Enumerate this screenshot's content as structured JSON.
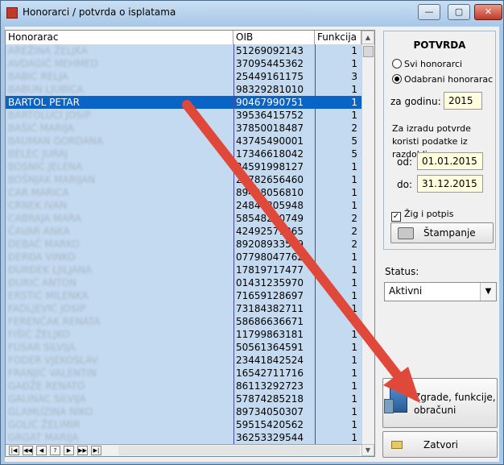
{
  "window": {
    "title": "Honorarci / potvrda o isplatama",
    "min_glyph": "—",
    "max_glyph": "▢",
    "close_glyph": "✕"
  },
  "grid": {
    "columns": [
      "Honorarac",
      "OIB",
      "Funkcija"
    ],
    "rows": [
      {
        "name": "AREŽINA ŽELJKA",
        "oib": "51269092143",
        "func": "1"
      },
      {
        "name": "AVDAGIĆ MEHMED",
        "oib": "37095445362",
        "func": "1"
      },
      {
        "name": "BABIĆ RELJA",
        "oib": "25449161175",
        "func": "3"
      },
      {
        "name": "BABUN LJUBICA",
        "oib": "98329281010",
        "func": "1"
      },
      {
        "name": "BARTOL PETAR",
        "oib": "90467990751",
        "func": "1",
        "selected": true
      },
      {
        "name": "BARTOLUCI JOSIP",
        "oib": "39536415752",
        "func": "1"
      },
      {
        "name": "BAŠIĆ MARIJA",
        "oib": "37850018487",
        "func": "2"
      },
      {
        "name": "BAUMAN GORDANA",
        "oib": "43745490001",
        "func": "5"
      },
      {
        "name": "BELEC JURAJ",
        "oib": "17346618042",
        "func": "5"
      },
      {
        "name": "BOSNIĆ JELENA",
        "oib": "24591998127",
        "func": "1"
      },
      {
        "name": "BOŠNJAK MARIJAN",
        "oib": "28782656460",
        "func": "1"
      },
      {
        "name": "CAR MARICA",
        "oib": "89438056810",
        "func": "1"
      },
      {
        "name": "CRNEK IVAN",
        "oib": "24848305948",
        "func": "1"
      },
      {
        "name": "CABRAJA MARA",
        "oib": "58548260749",
        "func": "2"
      },
      {
        "name": "ČAVAR ANKA",
        "oib": "42492571365",
        "func": "2"
      },
      {
        "name": "DEBAČ MARKO",
        "oib": "89208933549",
        "func": "2"
      },
      {
        "name": "ĐERĐA VINKO",
        "oib": "07798047762",
        "func": "1"
      },
      {
        "name": "ĐURĐEK LJILJANA",
        "oib": "17819717477",
        "func": "1"
      },
      {
        "name": "ĐURIĆ ANTON",
        "oib": "01431235970",
        "func": "1"
      },
      {
        "name": "ERSTIĆ MILENKA",
        "oib": "71659128697",
        "func": "1"
      },
      {
        "name": "FADLJEVIĆ JOSIP",
        "oib": "73184382711",
        "func": "1"
      },
      {
        "name": "FERENČAK RENATA",
        "oib": "58686636671",
        "func": "1"
      },
      {
        "name": "FIŠIĆ ŽELJKO",
        "oib": "11799863181",
        "func": "1"
      },
      {
        "name": "FUSAR SILVIJA",
        "oib": "50561364591",
        "func": "1"
      },
      {
        "name": "FODER VJEKOSLAV",
        "oib": "23441842524",
        "func": "1"
      },
      {
        "name": "FRANJIĆ VALENTIN",
        "oib": "16542711716",
        "func": "1"
      },
      {
        "name": "GAĐŽE RENATO",
        "oib": "86113292723",
        "func": "1"
      },
      {
        "name": "GALINAC SILVIJA",
        "oib": "57874285218",
        "func": "1"
      },
      {
        "name": "GLAMUZINA NIKO",
        "oib": "89734050307",
        "func": "1"
      },
      {
        "name": "GOLIĆ ŽELIMIR",
        "oib": "59515420562",
        "func": "1"
      },
      {
        "name": "GRGAT MARIJA",
        "oib": "36253329544",
        "func": "1"
      }
    ],
    "nav_buttons": [
      "|◀",
      "◀◀",
      "◀",
      "?",
      "▶",
      "▶▶",
      "▶|"
    ]
  },
  "potvrda": {
    "title": "POTVRDA",
    "radio_all": "Svi honorarci",
    "radio_selected": "Odabrani honorarac",
    "year_label": "za godinu:",
    "year_value": "2015",
    "note": "Za izradu potvrde koristi podatke iz razdoblja",
    "from_label": "od:",
    "from_value": "01.01.2015",
    "to_label": "do:",
    "to_value": "31.12.2015",
    "stamp_label": "Žig i potpis",
    "stamp_checked": true,
    "print_button": "Štampanje"
  },
  "status": {
    "label": "Status:",
    "value": "Aktivni"
  },
  "buttons": {
    "buildings": "Zgrade, funkcije, obračuni",
    "close": "Zatvori"
  },
  "colors": {
    "selection": "#0a64c8",
    "grid_bg": "#c4daf0",
    "arrow": "#e0483a",
    "input_yellow": "#ffffe0"
  }
}
